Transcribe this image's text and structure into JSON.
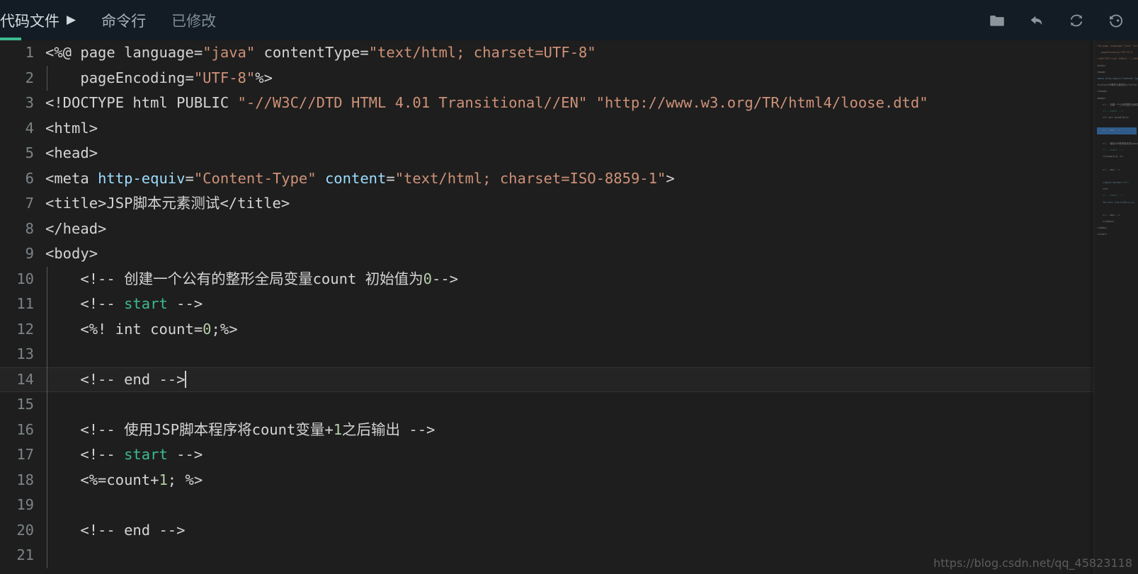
{
  "header": {
    "tabs": [
      {
        "label": "代码文件",
        "caret": "▶",
        "active": true
      },
      {
        "label": "命令行",
        "active": false
      },
      {
        "label": "已修改",
        "active": false
      }
    ],
    "accent_color": "#3dba8f",
    "background_color": "#131c24",
    "toolbar": [
      {
        "name": "folder-icon",
        "title": "打开文件夹"
      },
      {
        "name": "undo-icon",
        "title": "撤销"
      },
      {
        "name": "refresh-icon",
        "title": "刷新"
      },
      {
        "name": "history-restore-icon",
        "title": "还原"
      }
    ]
  },
  "editor": {
    "background_color": "#1e1e1e",
    "current_line": 14,
    "cursor_line": 14,
    "gutter_color": "#7d8487",
    "lines": [
      {
        "n": "1",
        "tokens": [
          {
            "t": "<%@ page ",
            "c": "def"
          },
          {
            "t": "language=",
            "c": "def"
          },
          {
            "t": "\"java\"",
            "c": "str"
          },
          {
            "t": " contentType=",
            "c": "def"
          },
          {
            "t": "\"text/html; charset=UTF-8\"",
            "c": "str"
          }
        ]
      },
      {
        "n": "2",
        "tokens": [
          {
            "t": "    pageEncoding=",
            "c": "def"
          },
          {
            "t": "\"UTF-8\"",
            "c": "str"
          },
          {
            "t": "%>",
            "c": "def"
          }
        ]
      },
      {
        "n": "3",
        "tokens": [
          {
            "t": "<!DOCTYPE html PUBLIC ",
            "c": "def"
          },
          {
            "t": "\"-//W3C//DTD HTML 4.01 Transitional//EN\"",
            "c": "str"
          },
          {
            "t": " ",
            "c": "def"
          },
          {
            "t": "\"http://www.w3.org/TR/html4/loose.dtd\"",
            "c": "str"
          }
        ]
      },
      {
        "n": "4",
        "tokens": [
          {
            "t": "<html>",
            "c": "def"
          }
        ]
      },
      {
        "n": "5",
        "tokens": [
          {
            "t": "<head>",
            "c": "def"
          }
        ]
      },
      {
        "n": "6",
        "tokens": [
          {
            "t": "<meta ",
            "c": "def"
          },
          {
            "t": "http-equiv",
            "c": "attr"
          },
          {
            "t": "=",
            "c": "def"
          },
          {
            "t": "\"Content-Type\"",
            "c": "str"
          },
          {
            "t": " ",
            "c": "def"
          },
          {
            "t": "content",
            "c": "attr"
          },
          {
            "t": "=",
            "c": "def"
          },
          {
            "t": "\"text/html; charset=ISO-8859-1\"",
            "c": "str"
          },
          {
            "t": ">",
            "c": "def"
          }
        ]
      },
      {
        "n": "7",
        "tokens": [
          {
            "t": "<title>",
            "c": "def"
          },
          {
            "t": "JSP",
            "c": "def"
          },
          {
            "t": "脚本元素测试",
            "c": "def",
            "cjk": true
          },
          {
            "t": "</title>",
            "c": "def"
          }
        ]
      },
      {
        "n": "8",
        "tokens": [
          {
            "t": "</head>",
            "c": "def"
          }
        ]
      },
      {
        "n": "9",
        "tokens": [
          {
            "t": "<body>",
            "c": "def"
          }
        ]
      },
      {
        "n": "10",
        "tokens": [
          {
            "t": "    <!-- ",
            "c": "cmt"
          },
          {
            "t": "创建一个公有的整形全局变量",
            "c": "cmt",
            "cjk": true
          },
          {
            "t": "count ",
            "c": "cmt"
          },
          {
            "t": "初始值为",
            "c": "cmt",
            "cjk": true
          },
          {
            "t": "0",
            "c": "num"
          },
          {
            "t": "-->",
            "c": "cmt"
          }
        ]
      },
      {
        "n": "11",
        "tokens": [
          {
            "t": "    <!-- ",
            "c": "cmt"
          },
          {
            "t": "start",
            "c": "kw"
          },
          {
            "t": " -->",
            "c": "cmt"
          }
        ]
      },
      {
        "n": "12",
        "tokens": [
          {
            "t": "    <%! int count=",
            "c": "def"
          },
          {
            "t": "0",
            "c": "num"
          },
          {
            "t": ";%>",
            "c": "def"
          }
        ]
      },
      {
        "n": "13",
        "tokens": []
      },
      {
        "n": "14",
        "tokens": [
          {
            "t": "    <!-- ",
            "c": "cmt"
          },
          {
            "t": "end",
            "c": "cmt"
          },
          {
            "t": " -->",
            "c": "cmt"
          }
        ],
        "cursor": true
      },
      {
        "n": "15",
        "tokens": []
      },
      {
        "n": "16",
        "tokens": [
          {
            "t": "    <!-- ",
            "c": "cmt"
          },
          {
            "t": "使用",
            "c": "cmt",
            "cjk": true
          },
          {
            "t": "JSP",
            "c": "cmt"
          },
          {
            "t": "脚本程序将",
            "c": "cmt",
            "cjk": true
          },
          {
            "t": "count",
            "c": "cmt"
          },
          {
            "t": "变量",
            "c": "cmt",
            "cjk": true
          },
          {
            "t": "+",
            "c": "cmt"
          },
          {
            "t": "1",
            "c": "num"
          },
          {
            "t": "之后输出",
            "c": "cmt",
            "cjk": true
          },
          {
            "t": " -->",
            "c": "cmt"
          }
        ]
      },
      {
        "n": "17",
        "tokens": [
          {
            "t": "    <!-- ",
            "c": "cmt"
          },
          {
            "t": "start",
            "c": "kw"
          },
          {
            "t": " -->",
            "c": "cmt"
          }
        ]
      },
      {
        "n": "18",
        "tokens": [
          {
            "t": "    <%=count+",
            "c": "def"
          },
          {
            "t": "1",
            "c": "num"
          },
          {
            "t": "; %>",
            "c": "def"
          }
        ]
      },
      {
        "n": "19",
        "tokens": []
      },
      {
        "n": "20",
        "tokens": [
          {
            "t": "    <!-- ",
            "c": "cmt"
          },
          {
            "t": "end",
            "c": "cmt"
          },
          {
            "t": " -->",
            "c": "cmt"
          }
        ]
      },
      {
        "n": "21",
        "tokens": []
      }
    ],
    "indent_guides": [
      {
        "from_line": 2,
        "to_line": 2
      },
      {
        "from_line": 10,
        "to_line": 21
      }
    ]
  },
  "minimap": {
    "lines": [
      {
        "t": "<%@ page language=\"java\" contentType=\"text/h",
        "k": "s"
      },
      {
        "t": "   pageEncoding=\"UTF-8\"%>",
        "k": "s"
      },
      {
        "t": "<!DOCTYPE html PUBLIC \"-//W3C//DTD HTML 4.0",
        "k": "s"
      },
      {
        "t": "<html>",
        "k": "d"
      },
      {
        "t": "<head>",
        "k": "d"
      },
      {
        "t": "<meta http-equiv=\"Content-Type\" content=\"te",
        "k": "a"
      },
      {
        "t": "<title>JSP脚本元素测试</title>",
        "k": "d"
      },
      {
        "t": "</head>",
        "k": "d"
      },
      {
        "t": "<body>",
        "k": "d"
      },
      {
        "t": "    <!-- 创建一个公有的整形全局变量count 初",
        "k": "d"
      },
      {
        "t": "    <!-- start -->",
        "k": "k"
      },
      {
        "t": "    <%! int count=0;%>",
        "k": "d"
      },
      {
        "t": "",
        "k": "d"
      },
      {
        "t": "    <!-- end -->",
        "k": "d",
        "current": true
      },
      {
        "t": "",
        "k": "d"
      },
      {
        "t": "    <!-- 使用JSP脚本程序将count变量+1之后",
        "k": "d"
      },
      {
        "t": "    <!-- start -->",
        "k": "k"
      },
      {
        "t": "    <%=count+1; %>",
        "k": "d"
      },
      {
        "t": "",
        "k": "d"
      },
      {
        "t": "    <!-- end -->",
        "k": "d"
      },
      {
        "t": "",
        "k": "d"
      },
      {
        "t": "    <table border=\"1\">",
        "k": "a"
      },
      {
        "t": "    <tr>",
        "k": "d"
      },
      {
        "t": "    <!-- start -->",
        "k": "k"
      },
      {
        "t": "    for(int i=0;i<10;i++){",
        "k": "a"
      },
      {
        "t": "",
        "k": "d"
      },
      {
        "t": "    <!-- end -->",
        "k": "d"
      },
      {
        "t": "    </table>",
        "k": "d"
      },
      {
        "t": "</body>",
        "k": "d"
      },
      {
        "t": "</html>",
        "k": "d"
      }
    ]
  },
  "watermark": {
    "text": "https://blog.csdn.net/qq_45823118"
  }
}
